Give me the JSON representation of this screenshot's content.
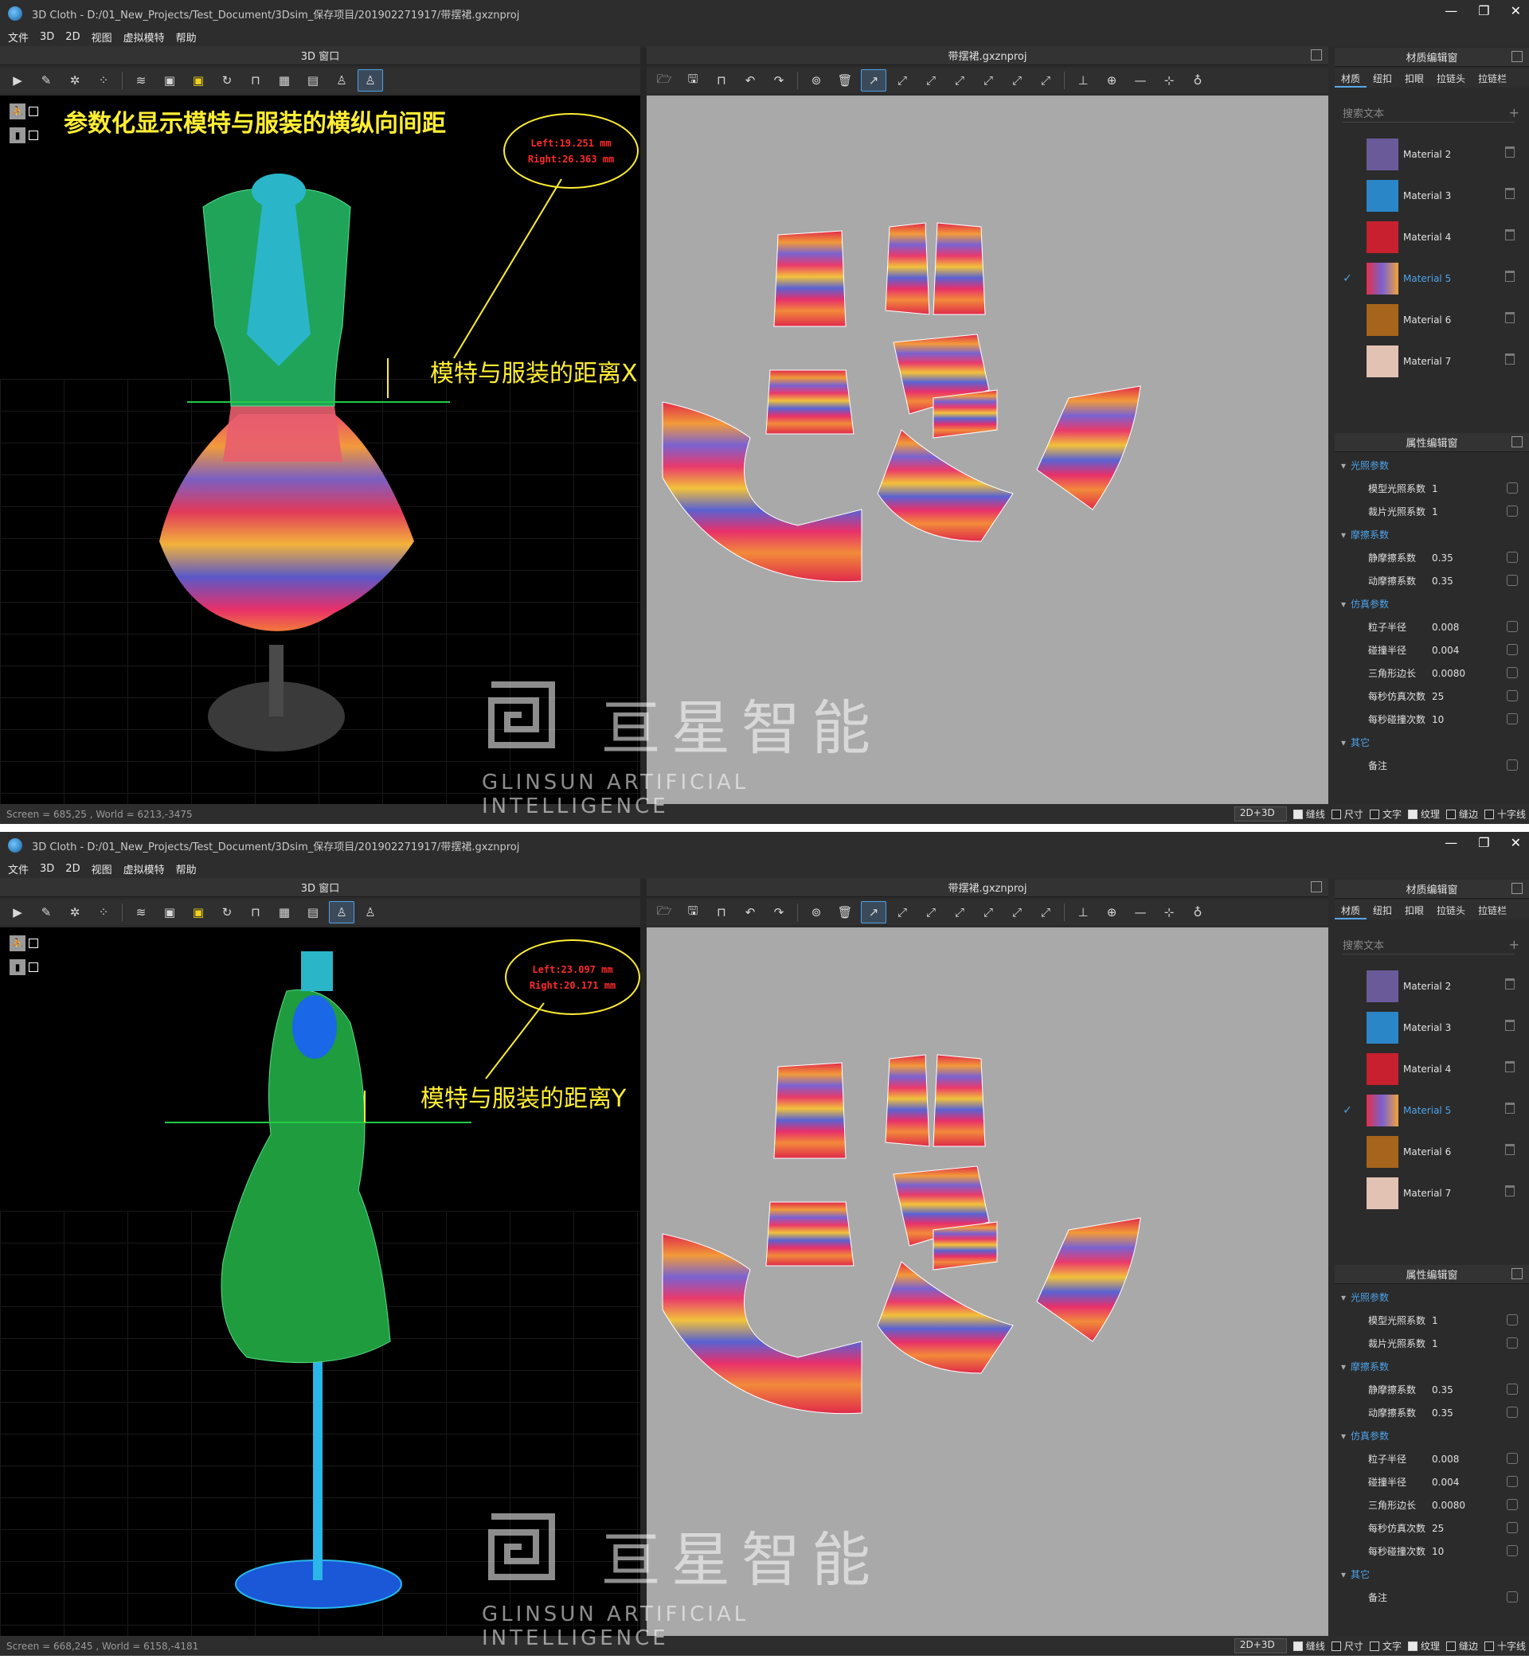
{
  "app": {
    "title_text": "3D Cloth - D:/01_New_Projects/Test_Document/3Dsim_保存项目/201902271917/带摆裙.gxznproj",
    "menu": [
      "文件",
      "3D",
      "2D",
      "视图",
      "虚拟模特",
      "帮助"
    ],
    "window_buttons": [
      "—",
      "❐",
      "✕"
    ]
  },
  "panels": {
    "view3d_title": "3D 窗口",
    "view2d_title": "带摆裙.gxznproj",
    "material_editor_title": "材质编辑窗",
    "property_editor_title": "属性编辑窗"
  },
  "material_tabs": [
    "材质",
    "纽扣",
    "扣眼",
    "拉链头",
    "拉链栏"
  ],
  "search_placeholder": "搜索文本",
  "materials": [
    {
      "name": "Material 2",
      "color": "#6a5a9a",
      "selected": false
    },
    {
      "name": "Material 3",
      "color": "#2a86c6",
      "selected": false
    },
    {
      "name": "Material 4",
      "color": "#c8202e",
      "selected": false
    },
    {
      "name": "Material 5",
      "color": "#d2357a",
      "selected": true
    },
    {
      "name": "Material 6",
      "color": "#a6641c",
      "selected": false
    },
    {
      "name": "Material 7",
      "color": "#e2c2b2",
      "selected": false
    }
  ],
  "properties": [
    {
      "group": "光照参数",
      "rows": [
        {
          "label": "模型光照系数",
          "value": "1"
        },
        {
          "label": "裁片光照系数",
          "value": "1"
        }
      ]
    },
    {
      "group": "摩擦系数",
      "rows": [
        {
          "label": "静摩擦系数",
          "value": "0.35"
        },
        {
          "label": "动摩擦系数",
          "value": "0.35"
        }
      ]
    },
    {
      "group": "仿真参数",
      "rows": [
        {
          "label": "粒子半径",
          "value": "0.008"
        },
        {
          "label": "碰撞半径",
          "value": "0.004"
        },
        {
          "label": "三角形边长",
          "value": "0.0080"
        },
        {
          "label": "每秒仿真次数",
          "value": "25"
        },
        {
          "label": "每秒碰撞次数",
          "value": "10"
        }
      ]
    },
    {
      "group": "其它",
      "rows": [
        {
          "label": "备注",
          "value": ""
        }
      ]
    }
  ],
  "statusbar": {
    "mode": "2D+3D",
    "options": [
      {
        "label": "缝线",
        "checked": true
      },
      {
        "label": "尺寸",
        "checked": false
      },
      {
        "label": "文字",
        "checked": false
      },
      {
        "label": "纹理",
        "checked": true
      },
      {
        "label": "缝边",
        "checked": false
      },
      {
        "label": "十字线",
        "checked": false
      }
    ]
  },
  "shots": [
    {
      "headline": "参数化显示模特与服装的横纵向间距",
      "distance_left": "Left:19.251 mm",
      "distance_right": "Right:26.363 mm",
      "distance_label": "模特与服装的距离X",
      "status_text": "Screen = 685,25 , World = 6213,-3475"
    },
    {
      "headline": "",
      "distance_left": "Left:23.097 mm",
      "distance_right": "Right:20.171 mm",
      "distance_label": "模特与服装的距离Y",
      "status_text": "Screen = 668,245 , World = 6158,-4181"
    }
  ],
  "watermark": {
    "cn": "亘星智能",
    "en": "GLINSUN ARTIFICIAL INTELLIGENCE"
  },
  "icons": {
    "view_toolbar": [
      "play-icon",
      "brush-icon",
      "scatter-icon",
      "points-icon",
      "wind-icon",
      "shirt-icon",
      "shirt-yellow-icon",
      "rotate-icon",
      "reset-icon",
      "grid-icon",
      "pattern-icon",
      "mannequin-icon",
      "mannequin-active-icon"
    ],
    "pattern_toolbar": [
      "open-icon",
      "save-icon",
      "export-icon",
      "undo-icon",
      "redo-icon",
      "camera-icon",
      "delete-icon",
      "select-icon",
      "seam-icon",
      "seam2-icon",
      "seam3-icon",
      "seam4-icon",
      "seam5-icon",
      "seam6-icon",
      "align-icon",
      "crosshair-icon",
      "line-icon",
      "target-icon",
      "pin-icon"
    ]
  }
}
